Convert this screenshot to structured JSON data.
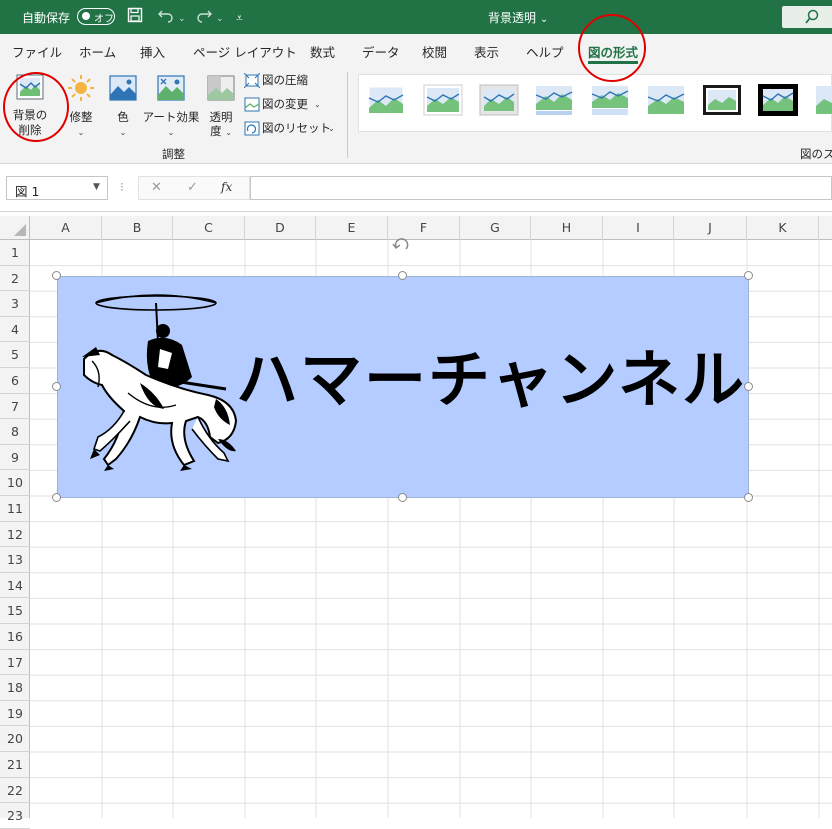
{
  "titlebar": {
    "autosave_label": "自動保存",
    "autosave_state": "オフ",
    "document_title": "背景透明",
    "title_caret": "⌄"
  },
  "tabs": [
    {
      "label": "ファイル"
    },
    {
      "label": "ホーム"
    },
    {
      "label": "挿入"
    },
    {
      "label": "ページ レイアウト"
    },
    {
      "label": "数式"
    },
    {
      "label": "データ"
    },
    {
      "label": "校閲"
    },
    {
      "label": "表示"
    },
    {
      "label": "ヘルプ"
    },
    {
      "label": "図の形式"
    }
  ],
  "ribbon": {
    "remove_bg_line1": "背景の",
    "remove_bg_line2": "削除",
    "corrections": "修整",
    "color": "色",
    "art_effects": "アート効果",
    "transparency_line1": "透明",
    "transparency_line2": "度",
    "compress": "図の圧縮",
    "change": "図の変更",
    "reset": "図のリセット",
    "group_adjust": "調整",
    "group_styles": "図のス"
  },
  "formula_bar": {
    "name_box": "図 1",
    "cancel": "✕",
    "enter": "✓",
    "fx": "fx",
    "formula": ""
  },
  "columns": [
    "A",
    "B",
    "C",
    "D",
    "E",
    "F",
    "G",
    "H",
    "I",
    "J",
    "K"
  ],
  "rows": [
    "1",
    "2",
    "3",
    "4",
    "5",
    "6",
    "7",
    "8",
    "9",
    "10",
    "11",
    "12",
    "13",
    "14",
    "15",
    "16",
    "17",
    "18",
    "19",
    "20",
    "21",
    "22",
    "23"
  ],
  "picture": {
    "caption": "ハマーチャンネル",
    "background_color": "#b4ccff"
  },
  "colors": {
    "excel_green": "#217346",
    "highlight_red": "#e00000"
  }
}
